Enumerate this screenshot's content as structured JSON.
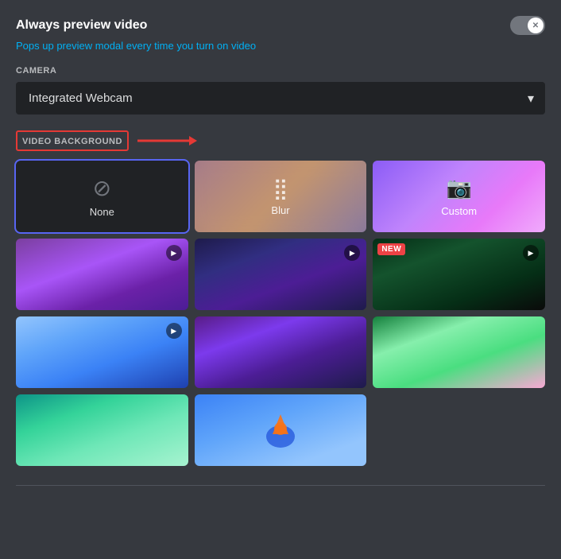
{
  "header": {
    "title": "Always preview video",
    "subtitle_text": "Pops up preview modal every time you ",
    "subtitle_action": "turn on video",
    "toggle_state": "off"
  },
  "camera": {
    "label": "CAMERA",
    "selected_value": "Integrated Webcam",
    "options": [
      "Integrated Webcam"
    ]
  },
  "video_background": {
    "label": "VIDEO BACKGROUND",
    "items": [
      {
        "id": "none",
        "label": "None",
        "type": "none",
        "selected": true
      },
      {
        "id": "blur",
        "label": "Blur",
        "type": "blur"
      },
      {
        "id": "custom",
        "label": "Custom",
        "type": "custom"
      },
      {
        "id": "bg1",
        "label": "",
        "type": "image",
        "style": "purple-mushroom",
        "has_play": true,
        "is_new": false
      },
      {
        "id": "bg2",
        "label": "",
        "type": "image",
        "style": "space-mushroom",
        "has_play": true,
        "is_new": false
      },
      {
        "id": "bg3",
        "label": "",
        "type": "image",
        "style": "hacker",
        "has_play": true,
        "is_new": true
      },
      {
        "id": "bg4",
        "label": "",
        "type": "image",
        "style": "ice-road",
        "has_play": true,
        "is_new": false
      },
      {
        "id": "bg5",
        "label": "",
        "type": "image",
        "style": "city-night",
        "has_play": false,
        "is_new": false
      },
      {
        "id": "bg6",
        "label": "",
        "type": "image",
        "style": "aerial",
        "has_play": false,
        "is_new": false
      },
      {
        "id": "bg7",
        "label": "",
        "type": "image",
        "style": "tropical",
        "has_play": false,
        "is_new": false
      },
      {
        "id": "bg8",
        "label": "",
        "type": "image",
        "style": "mascot",
        "has_play": false,
        "is_new": false
      }
    ]
  },
  "icons": {
    "none_icon": "⊘",
    "blur_icon": "⊟",
    "custom_icon": "📷",
    "play_icon": "▶",
    "new_badge": "NEW",
    "chevron_down": "▾",
    "toggle_x": "✕"
  }
}
